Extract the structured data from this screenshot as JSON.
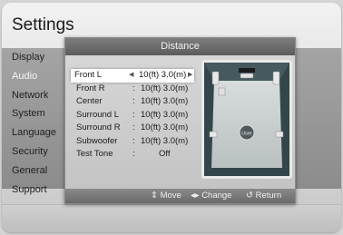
{
  "header": {
    "title": "Settings"
  },
  "sidebar": {
    "items": [
      {
        "label": "Display"
      },
      {
        "label": "Audio",
        "active": true
      },
      {
        "label": "Network"
      },
      {
        "label": "System"
      },
      {
        "label": "Language"
      },
      {
        "label": "Security"
      },
      {
        "label": "General"
      },
      {
        "label": "Support"
      }
    ]
  },
  "dialog": {
    "title": "Distance",
    "rows": [
      {
        "label": "Front L",
        "value": "10(ft) 3.0(m)",
        "selected": true
      },
      {
        "label": "Front R",
        "value": "10(ft) 3.0(m)"
      },
      {
        "label": "Center",
        "value": "10(ft) 3.0(m)"
      },
      {
        "label": "Surround L",
        "value": "10(ft) 3.0(m)"
      },
      {
        "label": "Surround R",
        "value": "10(ft) 3.0(m)"
      },
      {
        "label": "Subwoofer",
        "value": "10(ft) 3.0(m)"
      },
      {
        "label": "Test Tone",
        "value": "Off"
      }
    ],
    "separator": ":",
    "diagram": {
      "listener_label": "User"
    },
    "footer": {
      "move": "Move",
      "change": "Change",
      "return": "Return"
    }
  },
  "colors": {
    "dialog_header": "#6b6b6b",
    "room_wall": "#3a4e52",
    "room_floor": "#c9cfd0"
  }
}
